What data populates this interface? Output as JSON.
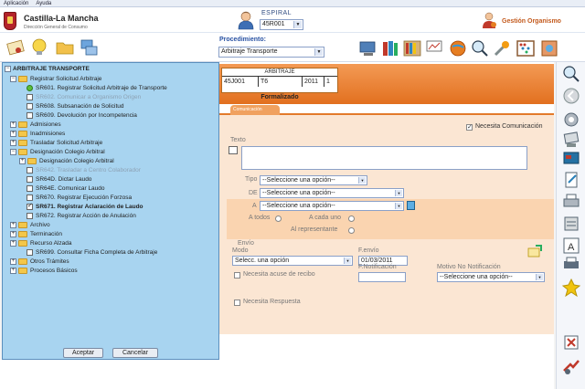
{
  "menu": [
    "Aplicación",
    "Ayuda"
  ],
  "header": {
    "logo_title": "Castilla-La Mancha",
    "logo_subtitle": "Dirección General de Consumo",
    "espiral_label": "ESPIRAL",
    "espiral_value": "45R001",
    "gestion_label": "Gestión Organismo"
  },
  "toolbar": {
    "procedimiento_label": "Procedimiento:",
    "procedimiento_value": "Arbitraje Transporte"
  },
  "case": {
    "header": "ARBITRAJE",
    "cells": [
      "45J001",
      "T6",
      "2011",
      "1"
    ],
    "status": "Formalizado"
  },
  "tab": {
    "label": "Comunicación"
  },
  "form": {
    "necesita_comunicacion": "Necesita Comunicación",
    "texto_label": "Texto",
    "tipo_label": "Tipo",
    "tipo_value": "--Seleccione una opción--",
    "de_label": "DE",
    "de_value": "--Seleccione una opción--",
    "a_label": "A",
    "a_value": "--Seleccione una opción--",
    "a_todos": "A todos",
    "a_cada_uno": "A cada uno",
    "al_representante": "Al representante",
    "envio_label": "Envío",
    "modo_label": "Modo",
    "modo_value": "Selecc. una opción",
    "f_envio_label": "F.envío",
    "f_envio_value": "01/03/2011",
    "acuse_label": "Necesita acuse de recibo",
    "f_notificacion_label": "F.Notificación",
    "motivo_label": "Motivo No Notificación",
    "motivo_value": "--Seleccione una opción--",
    "respuesta_label": "Necesita Respuesta"
  },
  "tree": {
    "root": "ARBITRAJE TRANSPORTE",
    "items": [
      {
        "label": "Registrar Solicitud Arbitraje"
      },
      {
        "label": "SR601. Registrar Solicitud Arbitraje de Transporte"
      },
      {
        "label": "SR602. Comunicar a Organismo Origen"
      },
      {
        "label": "SR608. Subsanación de Solicitud"
      },
      {
        "label": "SR609. Devolución por Incompetencia"
      },
      {
        "label": "Admisiones"
      },
      {
        "label": "Inadmisiones"
      },
      {
        "label": "Trasladar Solicitud Arbitraje"
      },
      {
        "label": "Designación Colegio Arbitral"
      },
      {
        "label": "Designación Colegio Arbitral"
      },
      {
        "label": "SR642. Trasladar a Centro Colaborador"
      },
      {
        "label": "SR64D. Dictar Laudo"
      },
      {
        "label": "SR64E. Comunicar Laudo"
      },
      {
        "label": "SR670. Registrar Ejecución Forzosa"
      },
      {
        "label": "SR671. Registrar Aclaración de Laudo"
      },
      {
        "label": "SR672. Registrar Acción de Anulación"
      },
      {
        "label": "Archivo"
      },
      {
        "label": "Terminación"
      },
      {
        "label": "Recurso Alzada"
      },
      {
        "label": "SR699. Consultar Ficha Completa de Arbitraje"
      },
      {
        "label": "Otros Trámites"
      },
      {
        "label": "Procesos Básicos"
      }
    ],
    "accept": "Aceptar",
    "cancel": "Cancelar"
  }
}
